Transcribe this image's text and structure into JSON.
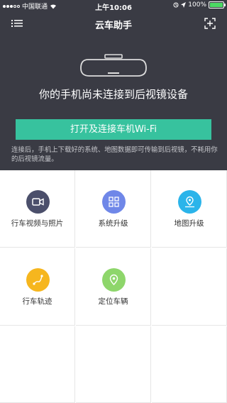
{
  "status_bar": {
    "carrier": "中国联通",
    "time": "上午10:06",
    "battery": "100%",
    "battery_level": 1.0
  },
  "navbar": {
    "title": "云车助手",
    "menu_icon": "menu-icon",
    "scan_icon": "scan-icon"
  },
  "hero": {
    "headline": "你的手机尚未连接到后视镜设备",
    "connect_button": "打开及连接车机Wi-Fi",
    "description": "连接后，手机上下载好的系统、地图数据即可传输到后视镜，不耗用你的后视镜流量。"
  },
  "grid": {
    "items": [
      {
        "label": "行车视频与照片",
        "icon": "camera-video-icon",
        "color": "#4b4f6b"
      },
      {
        "label": "系统升级",
        "icon": "grid-apps-icon",
        "color": "#6f87e8"
      },
      {
        "label": "地图升级",
        "icon": "map-pin-icon",
        "color": "#2bb4ea"
      },
      {
        "label": "行车轨迹",
        "icon": "route-icon",
        "color": "#f6b61e"
      },
      {
        "label": "定位车辆",
        "icon": "location-icon",
        "color": "#8ed66b"
      }
    ]
  },
  "colors": {
    "header_bg": "#3a3b44",
    "accent": "#37c29e"
  }
}
